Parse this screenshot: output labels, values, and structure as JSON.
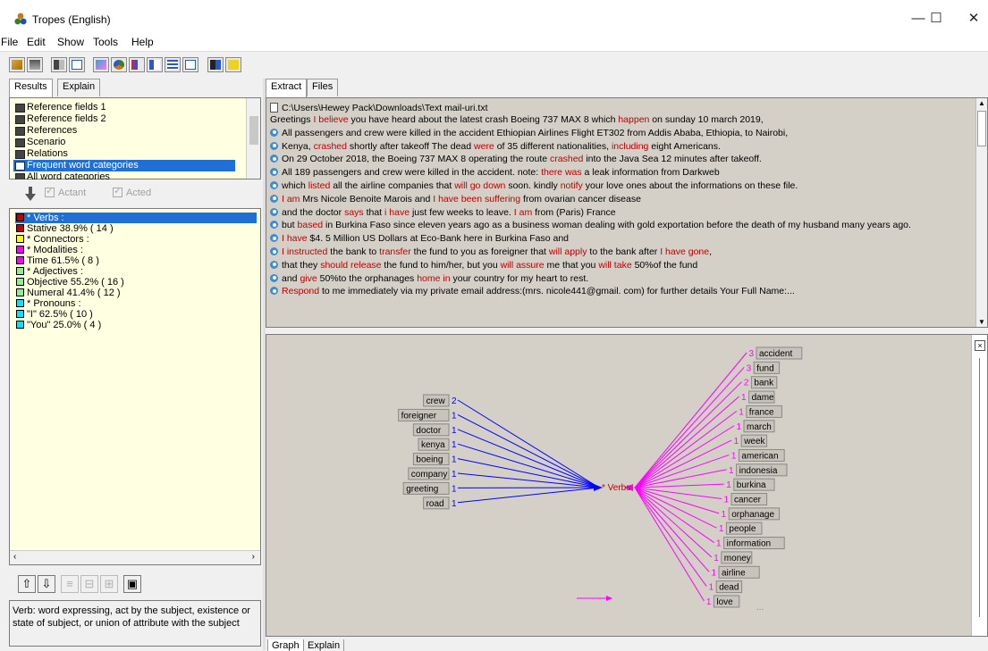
{
  "window": {
    "title": "Tropes (English)",
    "minimize_glyph": "—",
    "maximize_glyph": "☐",
    "close_glyph": "✕"
  },
  "menu": [
    "File",
    "Edit",
    "Show",
    "Tools",
    "Help"
  ],
  "left_tabs": [
    "Results",
    "Explain"
  ],
  "reference_list": {
    "items": [
      "Reference fields 1",
      "Reference fields 2",
      "References",
      "Scenario",
      "Relations",
      "Frequent word categories",
      "All word categories"
    ],
    "selected_index": 5
  },
  "actant_label": "Actant",
  "acted_label": "Acted",
  "categories": [
    {
      "label": "* Verbs :",
      "color": "#c00000",
      "selected": true
    },
    {
      "label": "Stative  38.9% ( 14 )",
      "color": "#c00000"
    },
    {
      "label": "* Connectors :",
      "color": "#ffff00"
    },
    {
      "label": "* Modalities :",
      "color": "#ff00ff"
    },
    {
      "label": "Time  61.5% ( 8 )",
      "color": "#ff00ff"
    },
    {
      "label": "* Adjectives :",
      "color": "#90ee90"
    },
    {
      "label": "Objective  55.2% ( 16 )",
      "color": "#90ee90"
    },
    {
      "label": "Numeral  41.4% ( 12 )",
      "color": "#90ee90"
    },
    {
      "label": "* Pronouns :",
      "color": "#00e5ff"
    },
    {
      "label": "\"I\"  62.5% ( 10 )",
      "color": "#00e5ff"
    },
    {
      "label": "\"You\"  25.0% ( 4 )",
      "color": "#00e5ff"
    }
  ],
  "definition": "Verb: word expressing, act by the subject, existence or state of subject, or union of attribute with the subject",
  "right_tabs": [
    "Extract",
    "Files"
  ],
  "extract": {
    "file_path": "C:\\Users\\Hewey Pack\\Downloads\\Text mail-uri.txt",
    "lines": [
      {
        "bullet": false,
        "segs": [
          [
            "Greetings ",
            0
          ],
          [
            "I believe",
            1
          ],
          [
            " you have heard about the latest crash Boeing 737 MAX 8 which ",
            0
          ],
          [
            "happen",
            1
          ],
          [
            " on sunday 10 march 2019,",
            0
          ]
        ]
      },
      {
        "bullet": true,
        "segs": [
          [
            "All passengers and crew were killed in the accident Ethiopian Airlines Flight ET302 from Addis Ababa, Ethiopia, to Nairobi,",
            0
          ]
        ]
      },
      {
        "bullet": true,
        "segs": [
          [
            "Kenya, ",
            0
          ],
          [
            "crashed",
            1
          ],
          [
            " shortly after takeoff The dead ",
            0
          ],
          [
            "were",
            1
          ],
          [
            " of 35 different nationalities,  ",
            0
          ],
          [
            "including",
            1
          ],
          [
            " eight Americans.",
            0
          ]
        ]
      },
      {
        "bullet": true,
        "segs": [
          [
            "On 29 October 2018, the Boeing 737 MAX 8 operating the route ",
            0
          ],
          [
            "crashed",
            1
          ],
          [
            " into the Java Sea 12 minutes after takeoff.",
            0
          ]
        ]
      },
      {
        "bullet": true,
        "segs": [
          [
            "All 189 passengers and crew were killed in the accident. note: ",
            0
          ],
          [
            "there was",
            1
          ],
          [
            " a leak information from Darkweb",
            0
          ]
        ]
      },
      {
        "bullet": true,
        "segs": [
          [
            "which ",
            0
          ],
          [
            "listed",
            1
          ],
          [
            " all the airline companies that ",
            0
          ],
          [
            "will go down",
            1
          ],
          [
            " soon. kindly ",
            0
          ],
          [
            "notify",
            1
          ],
          [
            " your love ones about the informations on these file.",
            0
          ]
        ]
      },
      {
        "bullet": true,
        "segs": [
          [
            "I am",
            1
          ],
          [
            " Mrs Nicole Benoite Marois and  ",
            0
          ],
          [
            "I have been suffering",
            1
          ],
          [
            " from ovarian cancer disease",
            0
          ]
        ]
      },
      {
        "bullet": true,
        "segs": [
          [
            "and the doctor ",
            0
          ],
          [
            "says",
            1
          ],
          [
            " that ",
            0
          ],
          [
            "i have",
            1
          ],
          [
            " just few weeks to leave. ",
            0
          ],
          [
            "I am",
            1
          ],
          [
            " from (Paris) France",
            0
          ]
        ]
      },
      {
        "bullet": true,
        "segs": [
          [
            "but ",
            0
          ],
          [
            "based",
            1
          ],
          [
            " in Burkina Faso since eleven years ago as a business woman dealing with gold exportation before the death of my husband many years ago.",
            0
          ]
        ]
      },
      {
        "bullet": true,
        "segs": [
          [
            "I have",
            1
          ],
          [
            " $4. 5 Million US Dollars at Eco-Bank here in Burkina Faso and",
            0
          ]
        ]
      },
      {
        "bullet": true,
        "segs": [
          [
            "I instructed",
            1
          ],
          [
            " the bank to ",
            0
          ],
          [
            "transfer",
            1
          ],
          [
            " the fund to you as foreigner that ",
            0
          ],
          [
            "will apply",
            1
          ],
          [
            " to the bank after ",
            0
          ],
          [
            "I have gone",
            1
          ],
          [
            ",",
            0
          ]
        ]
      },
      {
        "bullet": true,
        "segs": [
          [
            "that they ",
            0
          ],
          [
            "should release",
            1
          ],
          [
            " the fund to him/her,  but you ",
            0
          ],
          [
            "will assure",
            1
          ],
          [
            " me that you ",
            0
          ],
          [
            "will take",
            1
          ],
          [
            " 50%of the fund",
            0
          ]
        ]
      },
      {
        "bullet": true,
        "segs": [
          [
            "and ",
            0
          ],
          [
            "give",
            1
          ],
          [
            " 50%to the orphanages ",
            0
          ],
          [
            "home in",
            1
          ],
          [
            " your country for my heart to rest.",
            0
          ]
        ]
      },
      {
        "bullet": true,
        "segs": [
          [
            "Respond",
            1
          ],
          [
            " to me immediately via my private email address:(mrs. nicole441@gmail. com) for further details Your Full Name:...",
            0
          ]
        ]
      }
    ]
  },
  "graph": {
    "center_label": "* Verbs",
    "left_color": "#0000ff",
    "right_color": "#ff00ff",
    "left_nodes": [
      {
        "label": "crew",
        "count": "2"
      },
      {
        "label": "foreigner",
        "count": "1"
      },
      {
        "label": "doctor",
        "count": "1"
      },
      {
        "label": "kenya",
        "count": "1"
      },
      {
        "label": "boeing",
        "count": "1"
      },
      {
        "label": "company",
        "count": "1"
      },
      {
        "label": "greeting",
        "count": "1"
      },
      {
        "label": "road",
        "count": "1"
      }
    ],
    "right_nodes": [
      {
        "label": "accident",
        "count": "3"
      },
      {
        "label": "fund",
        "count": "3"
      },
      {
        "label": "bank",
        "count": "2"
      },
      {
        "label": "dame",
        "count": "1"
      },
      {
        "label": "france",
        "count": "1"
      },
      {
        "label": "march",
        "count": "1"
      },
      {
        "label": "week",
        "count": "1"
      },
      {
        "label": "american",
        "count": "1"
      },
      {
        "label": "indonesia",
        "count": "1"
      },
      {
        "label": "burkina",
        "count": "1"
      },
      {
        "label": "cancer",
        "count": "1"
      },
      {
        "label": "orphanage",
        "count": "1"
      },
      {
        "label": "people",
        "count": "1"
      },
      {
        "label": "information",
        "count": "1"
      },
      {
        "label": "money",
        "count": "1"
      },
      {
        "label": "airline",
        "count": "1"
      },
      {
        "label": "dead",
        "count": "1"
      },
      {
        "label": "love",
        "count": "1"
      }
    ],
    "more_indicator": "...",
    "close_glyph": "×"
  },
  "bottom_tabs": [
    "Graph",
    "Explain"
  ]
}
